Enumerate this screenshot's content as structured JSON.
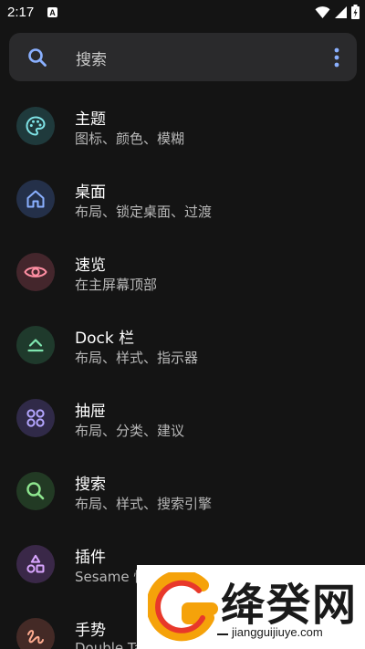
{
  "status_bar": {
    "time": "2:17",
    "notification_icon": "A",
    "icons": [
      "wifi-icon",
      "cellular-icon",
      "battery-icon"
    ]
  },
  "search": {
    "placeholder": "搜索",
    "icon": "search-icon",
    "menu_icon": "more-vert-icon"
  },
  "items": [
    {
      "title": "主题",
      "subtitle": "图标、颜色、模糊",
      "icon": "palette-icon",
      "icon_bg": "#1f3a3c",
      "icon_color": "#7fe3e6"
    },
    {
      "title": "桌面",
      "subtitle": "布局、锁定桌面、过渡",
      "icon": "home-icon",
      "icon_bg": "#243049",
      "icon_color": "#8ab0ff"
    },
    {
      "title": "速览",
      "subtitle": "在主屏幕顶部",
      "icon": "eye-icon",
      "icon_bg": "#44262c",
      "icon_color": "#ff8fa3"
    },
    {
      "title": "Dock 栏",
      "subtitle": "布局、样式、指示器",
      "icon": "dock-icon",
      "icon_bg": "#1f3a2c",
      "icon_color": "#7fe6b0"
    },
    {
      "title": "抽屉",
      "subtitle": "布局、分类、建议",
      "icon": "apps-grid-icon",
      "icon_bg": "#302a48",
      "icon_color": "#b4a6ff"
    },
    {
      "title": "搜索",
      "subtitle": "布局、样式、搜索引擎",
      "icon": "search-icon",
      "icon_bg": "#223a24",
      "icon_color": "#8ee68f"
    },
    {
      "title": "插件",
      "subtitle": "Sesame 快",
      "icon": "widgets-icon",
      "icon_bg": "#3a2848",
      "icon_color": "#d9a6ff"
    },
    {
      "title": "手势",
      "subtitle": "Double Ta",
      "icon": "gesture-icon",
      "icon_bg": "#442a26",
      "icon_color": "#ffab8f"
    }
  ],
  "watermark": {
    "title": "绛癸网",
    "url": "jiangguijiuye.com"
  },
  "colors": {
    "background": "#141414",
    "search_bg": "#2a2a2c",
    "accent_blue": "#8ab0ff"
  }
}
